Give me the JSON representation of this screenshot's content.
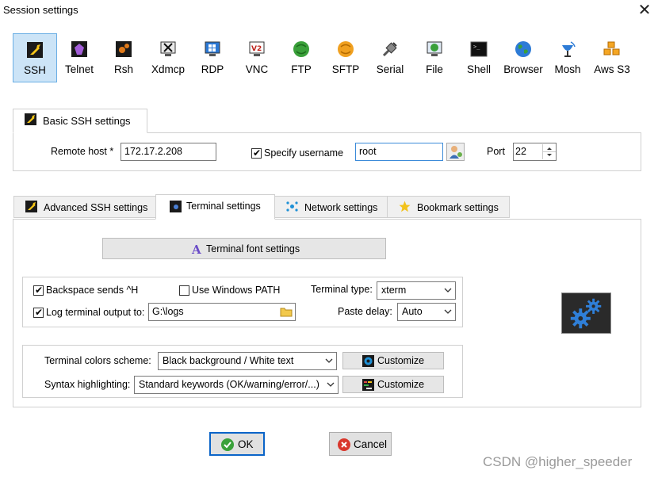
{
  "window": {
    "title": "Session settings"
  },
  "protocols": [
    {
      "label": "SSH",
      "icon": "wrench-icon"
    },
    {
      "label": "Telnet",
      "icon": "telnet-icon"
    },
    {
      "label": "Rsh",
      "icon": "rsh-icon"
    },
    {
      "label": "Xdmcp",
      "icon": "xdmcp-icon"
    },
    {
      "label": "RDP",
      "icon": "rdp-icon"
    },
    {
      "label": "VNC",
      "icon": "vnc-icon"
    },
    {
      "label": "FTP",
      "icon": "ftp-icon"
    },
    {
      "label": "SFTP",
      "icon": "sftp-icon"
    },
    {
      "label": "Serial",
      "icon": "serial-icon"
    },
    {
      "label": "File",
      "icon": "file-icon"
    },
    {
      "label": "Shell",
      "icon": "shell-icon"
    },
    {
      "label": "Browser",
      "icon": "globe-icon"
    },
    {
      "label": "Mosh",
      "icon": "mosh-icon"
    },
    {
      "label": "Aws S3",
      "icon": "aws-icon"
    }
  ],
  "basic": {
    "tab_label": "Basic SSH settings",
    "remote_host_label": "Remote host *",
    "remote_host_value": "172.17.2.208",
    "specify_username_label": "Specify username",
    "username_value": "root",
    "port_label": "Port",
    "port_value": "22"
  },
  "advanced_tabs": [
    {
      "label": "Advanced SSH settings"
    },
    {
      "label": "Terminal settings"
    },
    {
      "label": "Network settings"
    },
    {
      "label": "Bookmark settings"
    }
  ],
  "terminal": {
    "font_button": "Terminal font settings",
    "backspace_label": "Backspace sends ^H",
    "windows_path_label": "Use Windows PATH",
    "terminal_type_label": "Terminal type:",
    "terminal_type_value": "xterm",
    "log_output_label": "Log terminal output to:",
    "log_path_value": "G:\\logs",
    "paste_delay_label": "Paste delay:",
    "paste_delay_value": "Auto",
    "colors_label": "Terminal colors scheme:",
    "colors_value": "Black background / White text",
    "syntax_label": "Syntax highlighting:",
    "syntax_value": "Standard keywords (OK/warning/error/...)",
    "customize_label": "Customize",
    "customize2_label": "Customize"
  },
  "footer": {
    "ok_label": "OK",
    "cancel_label": "Cancel"
  },
  "watermark": "CSDN @higher_speeder"
}
